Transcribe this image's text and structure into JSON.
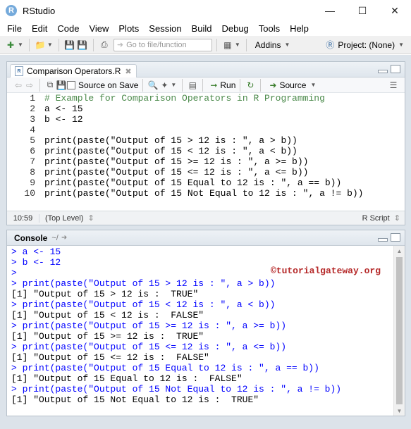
{
  "window": {
    "title": "RStudio",
    "app_icon": "R",
    "controls": [
      "minimize-icon",
      "maximize-icon",
      "close-icon"
    ]
  },
  "menubar": {
    "items": [
      "File",
      "Edit",
      "Code",
      "View",
      "Plots",
      "Session",
      "Build",
      "Debug",
      "Tools",
      "Help"
    ]
  },
  "toolbar": {
    "goto_placeholder": "Go to file/function",
    "addins_label": "Addins",
    "project_label": "Project: (None)"
  },
  "source_pane": {
    "tab_label": "Comparison Operators.R",
    "source_on_save_label": "Source on Save",
    "run_label": "Run",
    "source_label": "Source",
    "line_numbers": [
      "1",
      "2",
      "3",
      "4",
      "5",
      "6",
      "7",
      "8",
      "9",
      "10"
    ],
    "code_lines": [
      "# Example for Comparison Operators in R Programming",
      "a <- 15",
      "b <- 12",
      "",
      "print(paste(\"Output of 15 > 12 is : \", a > b))",
      "print(paste(\"Output of 15 < 12 is : \", a < b))",
      "print(paste(\"Output of 15 >= 12 is : \", a >= b))",
      "print(paste(\"Output of 15 <= 12 is : \", a <= b))",
      "print(paste(\"Output of 15 Equal to 12 is : \", a == b))",
      "print(paste(\"Output of 15 Not Equal to 12 is : \", a != b))"
    ],
    "status_position": "10:59",
    "status_scope": "(Top Level)",
    "status_lang": "R Script"
  },
  "console_pane": {
    "title": "Console",
    "path": "~/",
    "watermark": "©tutorialgateway.org",
    "lines": [
      {
        "kind": "cmd",
        "text": "> a <- 15"
      },
      {
        "kind": "cmd",
        "text": "> b <- 12"
      },
      {
        "kind": "cmd",
        "text": ">"
      },
      {
        "kind": "cmd",
        "text": "> print(paste(\"Output of 15 > 12 is : \", a > b))"
      },
      {
        "kind": "out",
        "text": "[1] \"Output of 15 > 12 is :  TRUE\""
      },
      {
        "kind": "cmd",
        "text": "> print(paste(\"Output of 15 < 12 is : \", a < b))"
      },
      {
        "kind": "out",
        "text": "[1] \"Output of 15 < 12 is :  FALSE\""
      },
      {
        "kind": "cmd",
        "text": "> print(paste(\"Output of 15 >= 12 is : \", a >= b))"
      },
      {
        "kind": "out",
        "text": "[1] \"Output of 15 >= 12 is :  TRUE\""
      },
      {
        "kind": "cmd",
        "text": "> print(paste(\"Output of 15 <= 12 is : \", a <= b))"
      },
      {
        "kind": "out",
        "text": "[1] \"Output of 15 <= 12 is :  FALSE\""
      },
      {
        "kind": "cmd",
        "text": "> print(paste(\"Output of 15 Equal to 12 is : \", a == b))"
      },
      {
        "kind": "out",
        "text": "[1] \"Output of 15 Equal to 12 is :  FALSE\""
      },
      {
        "kind": "cmd",
        "text": "> print(paste(\"Output of 15 Not Equal to 12 is : \", a != b))"
      },
      {
        "kind": "out",
        "text": "[1] \"Output of 15 Not Equal to 12 is :  TRUE\""
      }
    ],
    "prompt": ">"
  },
  "colors": {
    "console_command": "#0000ff",
    "comment": "#4b8a4b",
    "number": "#2f7ed8",
    "string": "#1f7a3a",
    "watermark": "#b52828"
  }
}
